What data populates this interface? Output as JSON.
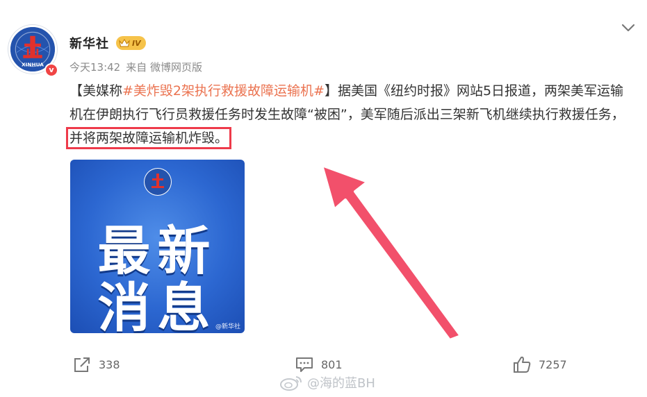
{
  "author": {
    "name": "新华社",
    "level": "IV",
    "verified_mark": "v",
    "avatar_text": "XINHUA",
    "avatar_icon": "xinhua-logo-icon"
  },
  "meta": {
    "time": "今天13:42",
    "source": "来自 微博网页版"
  },
  "post": {
    "bracket_open": "【美媒称",
    "hashtag": "#美炸毁2架执行救援故障运输机#",
    "bracket_close": "】",
    "body": "据美国《纽约时报》网站5日报道，两架美军运输机在伊朗执行飞行员救援任务时发生故障“被困”，美军随后派出三架新飞机继续执行救援任务，",
    "highlighted": "并将两架故障运输机炸毁。"
  },
  "image": {
    "line1": "最新",
    "line2": "消息",
    "watermark": "@新华社"
  },
  "actions": {
    "share_count": "338",
    "comment_count": "801",
    "like_count": "7257"
  },
  "watermark": {
    "text": "@海的蓝BH"
  },
  "colors": {
    "hashtag": "#eb7350",
    "highlight_box": "#ee3a4a",
    "arrow": "#f2506b",
    "brand_blue": "#2c67d1"
  }
}
